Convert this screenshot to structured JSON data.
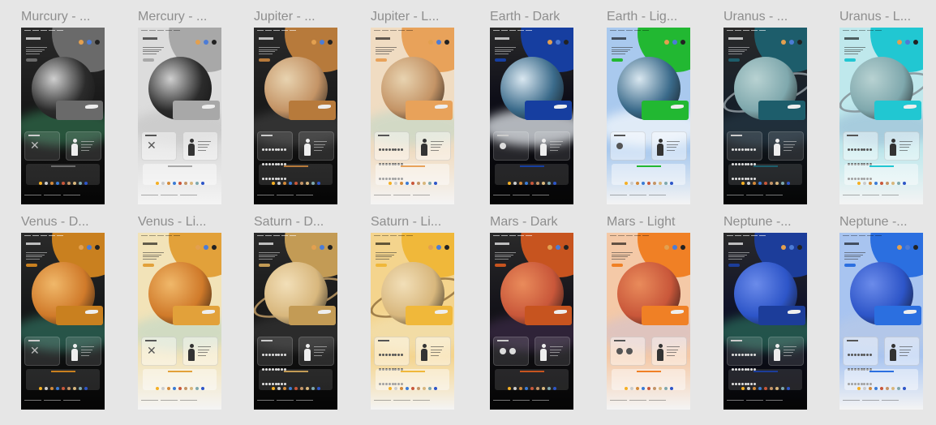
{
  "frames": [
    {
      "title": "Murcury - ...",
      "theme": "dark",
      "bg": "#1a1a1a",
      "accent": "#6a6a6a",
      "planet": "#2b2b2b",
      "planet_edge": "#cfcfcf",
      "cloud": "#2f6a4a",
      "text": "#ffffff",
      "moons_icon": "none",
      "ring": false
    },
    {
      "title": "Mercury - ...",
      "theme": "light",
      "bg": "#dcdcdc",
      "accent": "#a8a8a8",
      "planet": "#2b2b2b",
      "planet_edge": "#cfcfcf",
      "cloud": "#c7c7c7",
      "text": "#222222",
      "moons_icon": "none",
      "ring": false
    },
    {
      "title": "Jupiter - ...",
      "theme": "dark",
      "bg": "#1b1b1b",
      "accent": "#b77a3b",
      "planet": "#c49466",
      "planet_edge": "#e8d3b0",
      "cloud": "#3c3c3c",
      "text": "#ffffff",
      "moons_icon": "many",
      "ring": false
    },
    {
      "title": "Jupiter - L...",
      "theme": "light",
      "bg": "#f0dcc2",
      "accent": "#e8a25a",
      "planet": "#c49466",
      "planet_edge": "#e8d3b0",
      "cloud": "#c9d8c7",
      "text": "#222222",
      "moons_icon": "many",
      "ring": false
    },
    {
      "title": "Earth - Dark",
      "theme": "dark",
      "bg": "#0e0e18",
      "accent": "#163ea0",
      "planet": "#3a6a8a",
      "planet_edge": "#d9e7f0",
      "cloud": "#e9eef3",
      "text": "#ffffff",
      "moons_icon": "one",
      "ring": false
    },
    {
      "title": "Earth - Lig...",
      "theme": "light",
      "bg": "#a9c9ee",
      "accent": "#22b832",
      "planet": "#3a6a8a",
      "planet_edge": "#d9e7f0",
      "cloud": "#f3f7fb",
      "text": "#222222",
      "moons_icon": "one",
      "ring": false
    },
    {
      "title": "Uranus - ...",
      "theme": "dark",
      "bg": "#17202a",
      "accent": "#1d5d6b",
      "planet": "#7fa8ad",
      "planet_edge": "#b8d2d2",
      "cloud": "#253744",
      "text": "#ffffff",
      "moons_icon": "many",
      "ring": true,
      "ring_color": "#9aa4aa"
    },
    {
      "title": "Uranus - L...",
      "theme": "light",
      "bg": "#bfe8ec",
      "accent": "#21c7d2",
      "planet": "#7fa8ad",
      "planet_edge": "#b8d2d2",
      "cloud": "#9fc3d8",
      "text": "#222222",
      "moons_icon": "many",
      "ring": true,
      "ring_color": "#7f8a90"
    },
    {
      "title": "Venus - D...",
      "theme": "dark",
      "bg": "#17191a",
      "accent": "#c9801f",
      "planet": "#d07a2a",
      "planet_edge": "#f0b86a",
      "cloud": "#2f6a5a",
      "text": "#ffffff",
      "moons_icon": "none",
      "ring": false
    },
    {
      "title": "Venus - Li...",
      "theme": "light",
      "bg": "#f2e3b8",
      "accent": "#e2a13a",
      "planet": "#d07a2a",
      "planet_edge": "#f0b86a",
      "cloud": "#c7d9c6",
      "text": "#222222",
      "moons_icon": "none",
      "ring": false
    },
    {
      "title": "Saturn - D...",
      "theme": "dark",
      "bg": "#1a1a1a",
      "accent": "#c39b55",
      "planet": "#d8b77d",
      "planet_edge": "#f2dfb8",
      "cloud": "#333333",
      "text": "#ffffff",
      "moons_icon": "many",
      "ring": true,
      "ring_color": "#caa46a"
    },
    {
      "title": "Saturn - Li...",
      "theme": "light",
      "bg": "#f4d48d",
      "accent": "#f0b83a",
      "planet": "#d8b77d",
      "planet_edge": "#f2dfb8",
      "cloud": "#f2dfae",
      "text": "#222222",
      "moons_icon": "many",
      "ring": true,
      "ring_color": "#8c6a3a"
    },
    {
      "title": "Mars - Dark",
      "theme": "dark",
      "bg": "#15141a",
      "accent": "#c7541f",
      "planet": "#c9573a",
      "planet_edge": "#e98b5b",
      "cloud": "#3a2a45",
      "text": "#ffffff",
      "moons_icon": "two",
      "ring": false
    },
    {
      "title": "Mars - Light",
      "theme": "light",
      "bg": "#f4c9a7",
      "accent": "#f08025",
      "planet": "#c9573a",
      "planet_edge": "#e98b5b",
      "cloud": "#d9c3c6",
      "text": "#222222",
      "moons_icon": "two",
      "ring": false
    },
    {
      "title": "Neptune -...",
      "theme": "dark",
      "bg": "#11142a",
      "accent": "#1c3d9a",
      "planet": "#2d55c8",
      "planet_edge": "#6b8bea",
      "cloud": "#2a6a5a",
      "text": "#ffffff",
      "moons_icon": "many",
      "ring": false
    },
    {
      "title": "Neptune -...",
      "theme": "light",
      "bg": "#a8c4f0",
      "accent": "#2b6fe0",
      "planet": "#2d55c8",
      "planet_edge": "#6b8bea",
      "cloud": "#b7c9e7",
      "text": "#222222",
      "moons_icon": "many",
      "ring": false
    }
  ]
}
